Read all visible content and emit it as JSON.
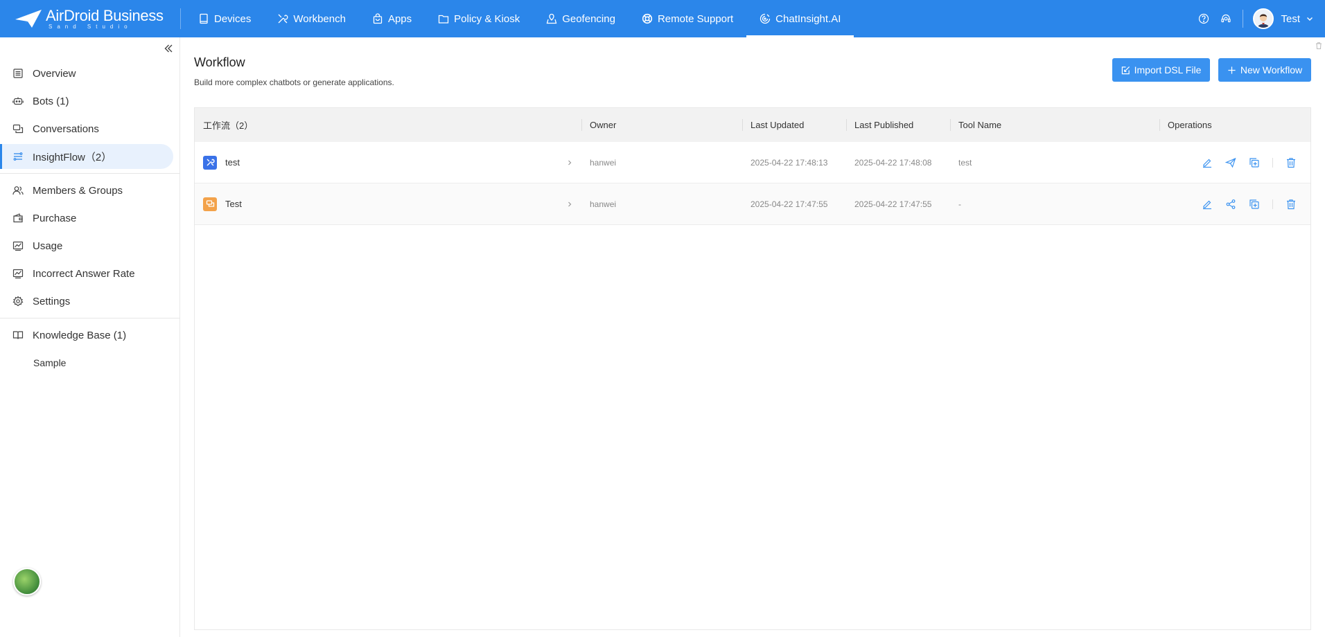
{
  "app": {
    "logo_name": "AirDroid Business",
    "logo_sub": "Sand Studio"
  },
  "nav": {
    "items": [
      {
        "label": "Devices",
        "icon": "device-icon"
      },
      {
        "label": "Workbench",
        "icon": "tools-icon"
      },
      {
        "label": "Apps",
        "icon": "bag-icon"
      },
      {
        "label": "Policy & Kiosk",
        "icon": "folder-icon"
      },
      {
        "label": "Geofencing",
        "icon": "location-icon"
      },
      {
        "label": "Remote Support",
        "icon": "lifebuoy-icon"
      },
      {
        "label": "ChatInsight.AI",
        "icon": "chat-ai-icon",
        "active": true
      }
    ],
    "user_name": "Test"
  },
  "sidebar": {
    "items": [
      {
        "label": "Overview",
        "icon": "list-icon"
      },
      {
        "label": "Bots (1)",
        "icon": "bot-icon"
      },
      {
        "label": "Conversations",
        "icon": "conversation-icon"
      },
      {
        "label": "InsightFlow（2）",
        "icon": "flow-icon",
        "active": true
      }
    ],
    "items2": [
      {
        "label": "Members & Groups",
        "icon": "users-icon"
      },
      {
        "label": "Purchase",
        "icon": "wallet-icon"
      },
      {
        "label": "Usage",
        "icon": "chart-icon"
      },
      {
        "label": "Incorrect Answer Rate",
        "icon": "chart-icon"
      },
      {
        "label": "Settings",
        "icon": "gear-icon"
      }
    ],
    "knowledge": {
      "label": "Knowledge Base (1)",
      "icon": "book-icon"
    },
    "knowledge_sub": "Sample"
  },
  "main": {
    "title": "Workflow",
    "subtitle": "Build more complex chatbots or generate applications.",
    "import_label": "Import DSL File",
    "new_label": "New Workflow"
  },
  "table": {
    "headers": [
      "工作流（2）",
      "Owner",
      "Last Updated",
      "Last Published",
      "Tool Name",
      "Operations"
    ],
    "rows": [
      {
        "name": "test",
        "owner": "hanwei",
        "updated": "2025-04-22 17:48:13",
        "published": "2025-04-22 17:48:08",
        "tool": "test",
        "icon_type": "tools",
        "color": "#3a72e8"
      },
      {
        "name": "Test",
        "owner": "hanwei",
        "updated": "2025-04-22 17:47:55",
        "published": "2025-04-22 17:47:55",
        "tool": "-",
        "icon_type": "chat",
        "color": "#f3a24a"
      }
    ]
  },
  "colors": {
    "brand": "#2b86ea",
    "button": "#3a92f0",
    "active_bg": "#e8f1fd"
  }
}
